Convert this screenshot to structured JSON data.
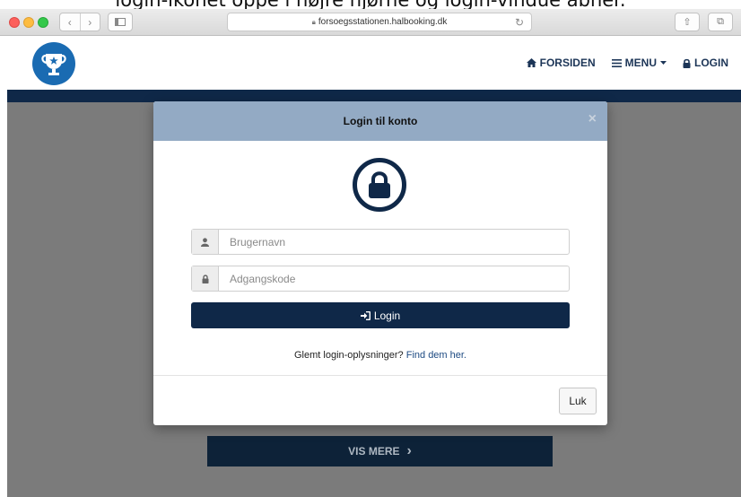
{
  "caption": "login-ikonet oppe i højre hjørne og login-vindue åbner.",
  "browser": {
    "url": "forsoegsstationen.halbooking.dk",
    "back_glyph": "‹",
    "forward_glyph": "›",
    "reload_glyph": "↻",
    "share_glyph": "⇧",
    "tabs_glyph": "⧉"
  },
  "header": {
    "nav": [
      {
        "icon": "home-icon",
        "label": "FORSIDEN"
      },
      {
        "icon": "menu-icon",
        "label": "MENU"
      },
      {
        "icon": "lock-icon",
        "label": "LOGIN"
      }
    ]
  },
  "modal": {
    "title": "Login til konto",
    "close_glyph": "×",
    "username_placeholder": "Brugernavn",
    "password_placeholder": "Adgangskode",
    "login_label": "Login",
    "forgot_text": "Glemt login-oplysninger?",
    "forgot_link": "Find dem her.",
    "close_button": "Luk"
  },
  "background": {
    "vis_mere_label": "VIS MERE",
    "vis_mere_glyph": "›"
  },
  "colors": {
    "navy": "#0f2848",
    "modal_header": "#93aac4",
    "logo_blue": "#1a6bb2",
    "backdrop": "#7b7b7b"
  }
}
